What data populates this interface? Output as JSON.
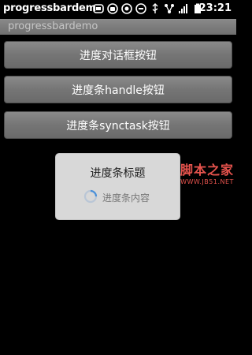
{
  "status_bar": {
    "app_label": "progressbardem",
    "time": "23:21",
    "icons": [
      "usb-icon",
      "android-icon",
      "circle-icon",
      "voicemail-icon",
      "usb-debug-icon",
      "alarm-icon",
      "signal-icon",
      "battery-icon"
    ]
  },
  "title_bar": {
    "title": "progressbardemo"
  },
  "buttons": [
    {
      "label": "进度对话框按钮"
    },
    {
      "label": "进度条handle按钮"
    },
    {
      "label": "进度条synctask按钮"
    }
  ],
  "dialog": {
    "title": "进度条标题",
    "message": "进度条内容"
  },
  "watermark": {
    "main": "脚本之家",
    "sub": "WWW.JB51.NET"
  },
  "colors": {
    "background": "#000000",
    "button": "#757575",
    "dialog": "#d8d8d8",
    "watermark": "#e6534d",
    "spinner": "#4a90d9"
  }
}
